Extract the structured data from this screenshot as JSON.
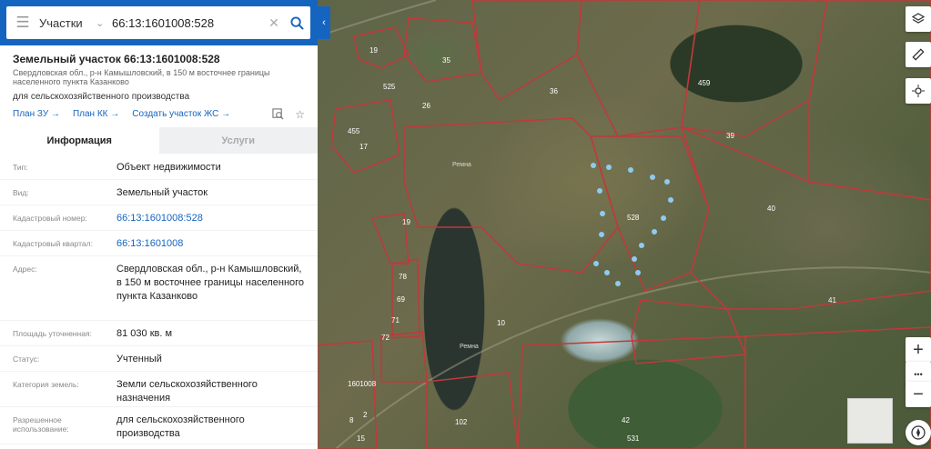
{
  "search": {
    "category": "Участки",
    "query": "66:13:1601008:528"
  },
  "card": {
    "title": "Земельный участок 66:13:1601008:528",
    "address_short": "Свердловская обл., р-н Камышловский, в 150 м восточнее границы населенного пункта Казанково",
    "purpose": "для сельскохозяйственного производства",
    "links": [
      "План ЗУ →",
      "План КК →",
      "Создать участок ЖС →"
    ]
  },
  "tabs": {
    "info": "Информация",
    "services": "Услуги"
  },
  "info_rows": [
    {
      "label": "Тип:",
      "value": "Объект недвижимости"
    },
    {
      "label": "Вид:",
      "value": "Земельный участок"
    },
    {
      "label": "Кадастровый номер:",
      "value": "66:13:1601008:528"
    },
    {
      "label": "Кадастровый квартал:",
      "value": "66:13:1601008"
    },
    {
      "label": "Адрес:",
      "value": "Свердловская обл., р-н Камышловский, в 150 м восточнее границы населенного пункта Казанково"
    },
    {
      "label": "Площадь уточненная:",
      "value": "81 030 кв. м"
    },
    {
      "label": "Статус:",
      "value": "Учтенный"
    },
    {
      "label": "Категория земель:",
      "value": "Земли сельскохозяйственного назначения"
    },
    {
      "label": "Разрешенное использование:",
      "value": "для сельскохозяйственного производства"
    }
  ],
  "map": {
    "parcel_labels": [
      "19",
      "35",
      "36",
      "525",
      "26",
      "17",
      "455",
      "39",
      "40",
      "459",
      "528",
      "19",
      "78",
      "69",
      "71",
      "72",
      "10",
      "41",
      "1601008",
      "8",
      "2",
      "15",
      "102",
      "42",
      "531"
    ],
    "river_labels": [
      "Ремна",
      "Ремна"
    ],
    "controls": {
      "zoom_in": "+",
      "more": "•••"
    }
  },
  "colors": {
    "brand": "#1565c0",
    "parcel_border": "#c0393b",
    "selected_points": "#8ecbf0"
  }
}
